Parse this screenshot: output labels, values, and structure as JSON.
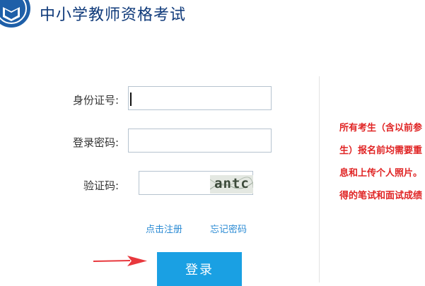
{
  "header": {
    "title": "中小学教师资格考试",
    "logo_icon": "book-shield-icon",
    "brand_color": "#0f3a7a"
  },
  "form": {
    "id_label": "身份证号:",
    "id_value": "",
    "password_label": "登录密码:",
    "password_value": "",
    "captcha_label": "验证码:",
    "captcha_value": "",
    "captcha_image_text": "antc"
  },
  "links": {
    "register": "点击注册",
    "forgot_password": "忘记密码"
  },
  "login_button": "登录",
  "notice": {
    "color": "#e02424",
    "lines": [
      "所有考生（含以前参",
      "生）报名前均需要重",
      "息和上传个人照片。",
      "得的笔试和面试成绩"
    ]
  },
  "colors": {
    "button": "#1aa0e3",
    "link": "#2b8bd4",
    "arrow": "#e8383d"
  }
}
